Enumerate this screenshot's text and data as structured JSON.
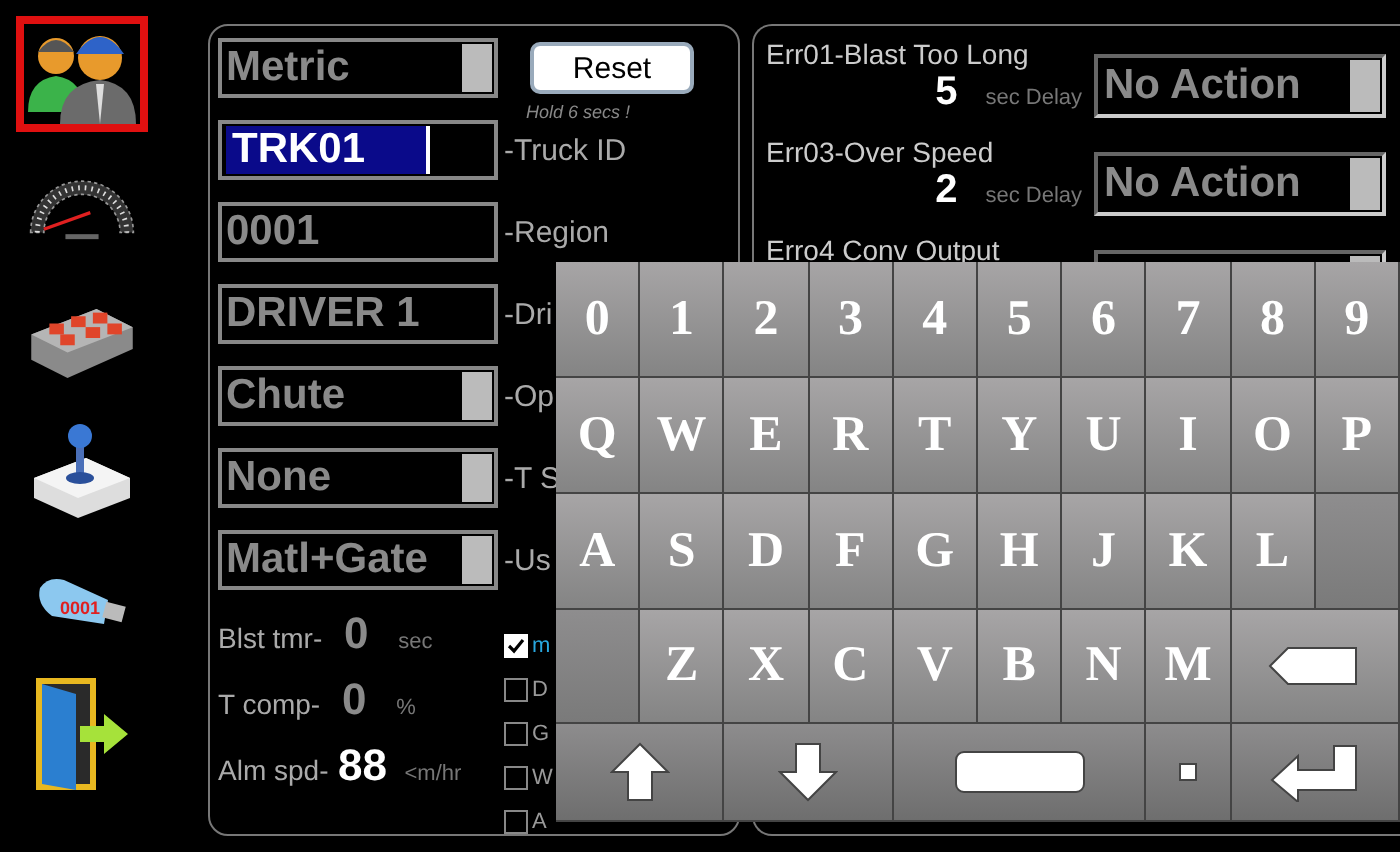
{
  "sidebar": {
    "items": [
      {
        "kind": "users",
        "selected": true
      },
      {
        "kind": "speedometer",
        "selected": false
      },
      {
        "kind": "valve",
        "selected": false
      },
      {
        "kind": "joystick",
        "selected": false
      },
      {
        "kind": "usb",
        "selected": false,
        "label": "0001"
      },
      {
        "kind": "exit",
        "selected": false
      }
    ]
  },
  "settings": {
    "units": "Metric",
    "reset_button": "Reset",
    "reset_hint": "Hold 6 secs !",
    "fields": [
      {
        "kind": "input",
        "value": "TRK01",
        "selected": true,
        "label": "-Truck ID"
      },
      {
        "kind": "input",
        "value": "0001",
        "selected": false,
        "label": "-Region"
      },
      {
        "kind": "input",
        "value": "DRIVER 1",
        "selected": false,
        "label": "-Dri"
      },
      {
        "kind": "dropdown",
        "value": "Chute",
        "selected": false,
        "label": "-Op"
      },
      {
        "kind": "dropdown",
        "value": "None",
        "selected": false,
        "label": "-T S"
      },
      {
        "kind": "dropdown",
        "value": "Matl+Gate",
        "selected": false,
        "label": "-Us"
      }
    ],
    "readings": [
      {
        "label": "Blst tmr-",
        "value": "0",
        "unit": "sec",
        "bright": false
      },
      {
        "label": "T comp-",
        "value": "0",
        "unit": "%",
        "bright": false
      },
      {
        "label": "Alm spd-",
        "value": "88",
        "unit": "<m/hr",
        "bright": true
      }
    ],
    "checkboxes": [
      {
        "label": "m",
        "checked": true
      },
      {
        "label": "D",
        "checked": false
      },
      {
        "label": "G",
        "checked": false
      },
      {
        "label": "W",
        "checked": false
      },
      {
        "label": "A",
        "checked": false
      }
    ]
  },
  "errors": [
    {
      "label": "Err01-Blast Too Long",
      "delay": "5",
      "unit": "sec Delay",
      "action": "No Action"
    },
    {
      "label": "Err03-Over Speed",
      "delay": "2",
      "unit": "sec Delay",
      "action": "No Action"
    },
    {
      "label": "Erro4 Conv Output"
    }
  ],
  "keyboard": {
    "rows": [
      [
        {
          "kind": "char",
          "label": "0"
        },
        {
          "kind": "char",
          "label": "1"
        },
        {
          "kind": "char",
          "label": "2"
        },
        {
          "kind": "char",
          "label": "3"
        },
        {
          "kind": "char",
          "label": "4"
        },
        {
          "kind": "char",
          "label": "5"
        },
        {
          "kind": "char",
          "label": "6"
        },
        {
          "kind": "char",
          "label": "7"
        },
        {
          "kind": "char",
          "label": "8"
        },
        {
          "kind": "char",
          "label": "9"
        }
      ],
      [
        {
          "kind": "char",
          "label": "Q"
        },
        {
          "kind": "char",
          "label": "W"
        },
        {
          "kind": "char",
          "label": "E"
        },
        {
          "kind": "char",
          "label": "R"
        },
        {
          "kind": "char",
          "label": "T"
        },
        {
          "kind": "char",
          "label": "Y"
        },
        {
          "kind": "char",
          "label": "U"
        },
        {
          "kind": "char",
          "label": "I"
        },
        {
          "kind": "char",
          "label": "O"
        },
        {
          "kind": "char",
          "label": "P"
        }
      ],
      [
        {
          "kind": "char",
          "label": "A"
        },
        {
          "kind": "char",
          "label": "S"
        },
        {
          "kind": "char",
          "label": "D"
        },
        {
          "kind": "char",
          "label": "F"
        },
        {
          "kind": "char",
          "label": "G"
        },
        {
          "kind": "char",
          "label": "H"
        },
        {
          "kind": "char",
          "label": "J"
        },
        {
          "kind": "char",
          "label": "K"
        },
        {
          "kind": "char",
          "label": "L"
        },
        {
          "kind": "blank"
        }
      ],
      [
        {
          "kind": "blank"
        },
        {
          "kind": "char",
          "label": "Z"
        },
        {
          "kind": "char",
          "label": "X"
        },
        {
          "kind": "char",
          "label": "C"
        },
        {
          "kind": "char",
          "label": "V"
        },
        {
          "kind": "char",
          "label": "B"
        },
        {
          "kind": "char",
          "label": "N"
        },
        {
          "kind": "char",
          "label": "M"
        },
        {
          "kind": "backspace"
        }
      ],
      [
        {
          "kind": "shift"
        },
        {
          "kind": "down"
        },
        {
          "kind": "space"
        },
        {
          "kind": "dot"
        },
        {
          "kind": "enter"
        }
      ]
    ]
  }
}
